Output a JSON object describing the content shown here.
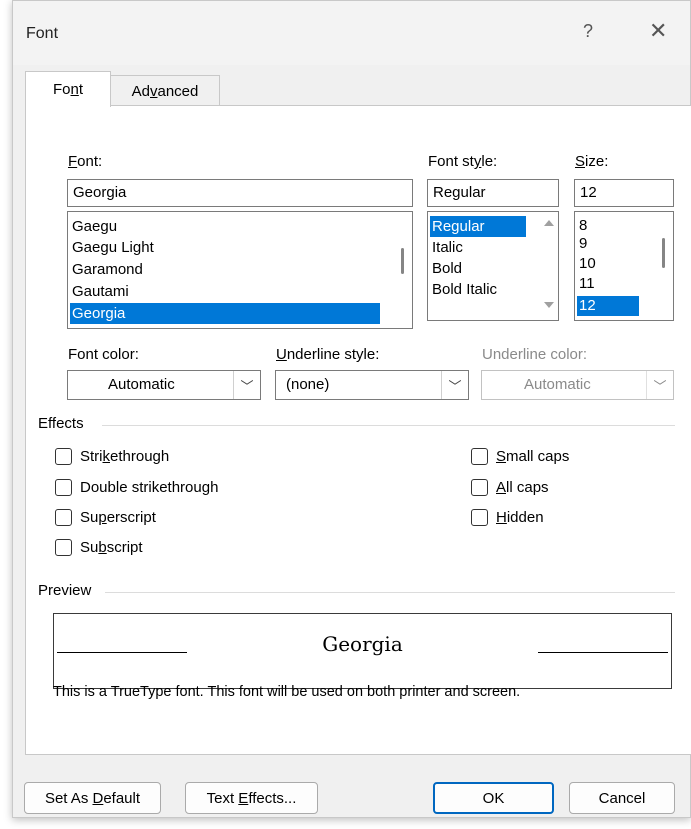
{
  "window": {
    "title": "Font",
    "help_glyph": "?",
    "close_glyph": "✕"
  },
  "tabs": [
    {
      "label_pre": "Fo",
      "label_u": "n",
      "label_post": "t",
      "active": true
    },
    {
      "label_pre": "Ad",
      "label_u": "v",
      "label_post": "anced",
      "active": false
    }
  ],
  "font": {
    "label_pre": "",
    "label_u": "F",
    "label_post": "ont:",
    "value": "Georgia",
    "list": [
      "Gaegu",
      "Gaegu Light",
      "Garamond",
      "Gautami",
      "Georgia"
    ],
    "selected_index": 4
  },
  "font_style": {
    "label_pre": "Font st",
    "label_u": "y",
    "label_post": "le:",
    "value": "Regular",
    "list": [
      "Regular",
      "Italic",
      "Bold",
      "Bold Italic"
    ],
    "selected_index": 0
  },
  "size": {
    "label_pre": "",
    "label_u": "S",
    "label_post": "ize:",
    "value": "12",
    "list": [
      "8",
      "9",
      "10",
      "11",
      "12"
    ],
    "selected_index": 4
  },
  "font_color": {
    "label": "Font color:",
    "value": "Automatic"
  },
  "underline_style": {
    "label_pre": "",
    "label_u": "U",
    "label_post": "nderline style:",
    "value": "(none)"
  },
  "underline_color": {
    "label": "Underline color:",
    "value": "Automatic"
  },
  "effects": {
    "title": "Effects",
    "left": [
      {
        "pre": "Stri",
        "u": "k",
        "post": "ethrough",
        "checked": false
      },
      {
        "pre": "Double strikethrou",
        "u": "g",
        "post": "h",
        "checked": false
      },
      {
        "pre": "Su",
        "u": "p",
        "post": "erscript",
        "checked": false
      },
      {
        "pre": "Su",
        "u": "b",
        "post": "script",
        "checked": false
      }
    ],
    "right": [
      {
        "pre": "",
        "u": "S",
        "post": "mall caps",
        "checked": false
      },
      {
        "pre": "",
        "u": "A",
        "post": "ll caps",
        "checked": false
      },
      {
        "pre": "",
        "u": "H",
        "post": "idden",
        "checked": false
      }
    ]
  },
  "preview": {
    "title": "Preview",
    "sample": "Georgia",
    "note": "This is a TrueType font. This font will be used on both printer and screen."
  },
  "buttons": {
    "set_default": {
      "pre": "Set As ",
      "u": "D",
      "post": "efault"
    },
    "text_effects": {
      "pre": "Text ",
      "u": "E",
      "post": "ffects..."
    },
    "ok": "OK",
    "cancel": "Cancel"
  }
}
